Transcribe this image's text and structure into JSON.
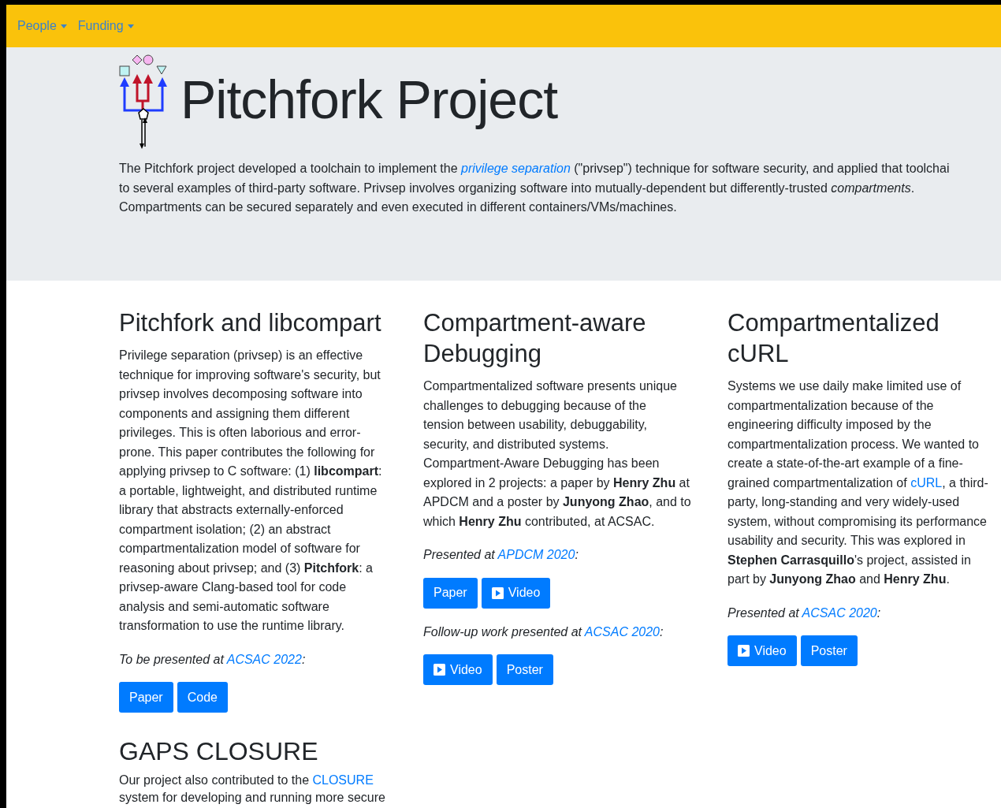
{
  "nav": [
    {
      "label": "People"
    },
    {
      "label": "Funding"
    }
  ],
  "header": {
    "title": "Pitchfork Project",
    "intro": [
      [
        {
          "text": "The Pitchfork project developed a toolchain to implement the "
        },
        {
          "link": "privilege separation",
          "italic": true
        },
        {
          "text": " (\"privsep\") technique for software security, and applied that toolchai"
        }
      ],
      [
        {
          "text": "to several examples of third-party software. Privsep involves organizing software into mutually-dependent but differently-trusted *compartments*."
        }
      ],
      [
        {
          "text": "Compartments can be secured separately and even executed in different containers/VMs/machines."
        }
      ]
    ]
  },
  "columns": [
    {
      "heading": "Pitchfork and libcompart",
      "blocks": [
        {
          "kind": "paragraph",
          "lines": [
            [
              {
                "text": "Privilege separation (privsep) is an effective"
              }
            ],
            [
              {
                "text": "technique for improving software's security, but"
              }
            ],
            [
              {
                "text": "privsep involves decomposing software into"
              }
            ],
            [
              {
                "text": "components and assigning them different"
              }
            ],
            [
              {
                "text": "privileges. This is often laborious and error-"
              }
            ],
            [
              {
                "text": "prone. This paper contributes the following for"
              }
            ],
            [
              {
                "text": "applying privsep to C software: (1) **libcompart**:"
              }
            ],
            [
              {
                "text": "a portable, lightweight, and distributed runtime"
              }
            ],
            [
              {
                "text": "library that abstracts externally-enforced"
              }
            ],
            [
              {
                "text": "compartment isolation; (2) an abstract"
              }
            ],
            [
              {
                "text": "compartmentalization model of software for"
              }
            ],
            [
              {
                "text": "reasoning about privsep; and (3) **Pitchfork**: a"
              }
            ],
            [
              {
                "text": "privsep-aware Clang-based tool for code"
              }
            ],
            [
              {
                "text": "analysis and semi-automatic software"
              }
            ],
            [
              {
                "text": "transformation to use the runtime library."
              }
            ]
          ]
        },
        {
          "kind": "note",
          "lines": [
            [
              {
                "text": "To be presented at "
              },
              {
                "link": "ACSAC 2022"
              },
              {
                "text": ":"
              }
            ]
          ]
        },
        {
          "kind": "buttons",
          "buttons": [
            {
              "label": "Paper",
              "kind": "plain"
            },
            {
              "label": "Code",
              "kind": "plain"
            }
          ]
        }
      ]
    },
    {
      "heading": "Compartment-aware Debugging",
      "blocks": [
        {
          "kind": "paragraph",
          "lines": [
            [
              {
                "text": "Compartmentalized software presents unique"
              }
            ],
            [
              {
                "text": "challenges to debugging because of the"
              }
            ],
            [
              {
                "text": "tension between usability, debuggability,"
              }
            ],
            [
              {
                "text": "security, and distributed systems."
              }
            ],
            [
              {
                "text": "Compartment-Aware Debugging has been"
              }
            ],
            [
              {
                "text": "explored in 2 projects: a paper by **Henry Zhu** at"
              }
            ],
            [
              {
                "text": "APDCM and a poster by **Junyong Zhao**, and to"
              }
            ],
            [
              {
                "text": "which **Henry Zhu** contributed, at ACSAC."
              }
            ]
          ]
        },
        {
          "kind": "note",
          "lines": [
            [
              {
                "text": "Presented at "
              },
              {
                "link": "APDCM 2020"
              },
              {
                "text": ":"
              }
            ]
          ]
        },
        {
          "kind": "buttons",
          "buttons": [
            {
              "label": "Paper",
              "kind": "plain"
            },
            {
              "label": "Video",
              "kind": "video"
            }
          ]
        },
        {
          "kind": "note",
          "lines": [
            [
              {
                "text": "Follow-up work presented at "
              },
              {
                "link": "ACSAC 2020"
              },
              {
                "text": ":"
              }
            ]
          ]
        },
        {
          "kind": "buttons",
          "buttons": [
            {
              "label": "Video",
              "kind": "video"
            },
            {
              "label": "Poster",
              "kind": "plain"
            }
          ]
        }
      ]
    },
    {
      "heading": "Compartmentalized cURL",
      "blocks": [
        {
          "kind": "paragraph",
          "lines": [
            [
              {
                "text": "Systems we use daily make limited use of"
              }
            ],
            [
              {
                "text": "compartmentalization because of the"
              }
            ],
            [
              {
                "text": "engineering difficulty imposed by the"
              }
            ],
            [
              {
                "text": "compartmentalization process. We wanted to"
              }
            ],
            [
              {
                "text": "create a state-of-the-art example of a fine-"
              }
            ],
            [
              {
                "text": "grained compartmentalization of "
              },
              {
                "link": "cURL"
              },
              {
                "text": ", a third-"
              }
            ],
            [
              {
                "text": "party, long-standing and very widely-used"
              }
            ],
            [
              {
                "text": "system, without compromising its performance"
              }
            ],
            [
              {
                "text": "usability and security. This was explored in"
              }
            ],
            [
              {
                "text": "**Stephen Carrasquillo**'s project, assisted in"
              }
            ],
            [
              {
                "text": "part by **Junyong Zhao** and **Henry Zhu**."
              }
            ]
          ]
        },
        {
          "kind": "note",
          "lines": [
            [
              {
                "text": "Presented at "
              },
              {
                "link": "ACSAC 2020"
              },
              {
                "text": ":"
              }
            ]
          ]
        },
        {
          "kind": "buttons",
          "buttons": [
            {
              "label": "Video",
              "kind": "video"
            },
            {
              "label": "Poster",
              "kind": "plain"
            }
          ]
        }
      ]
    }
  ],
  "section": {
    "heading": "GAPS CLOSURE",
    "lines": [
      [
        {
          "text": "Our project also contributed to the "
        },
        {
          "link": "CLOSURE"
        }
      ],
      [
        {
          "text": "system for developing and running more secure"
        }
      ]
    ]
  }
}
